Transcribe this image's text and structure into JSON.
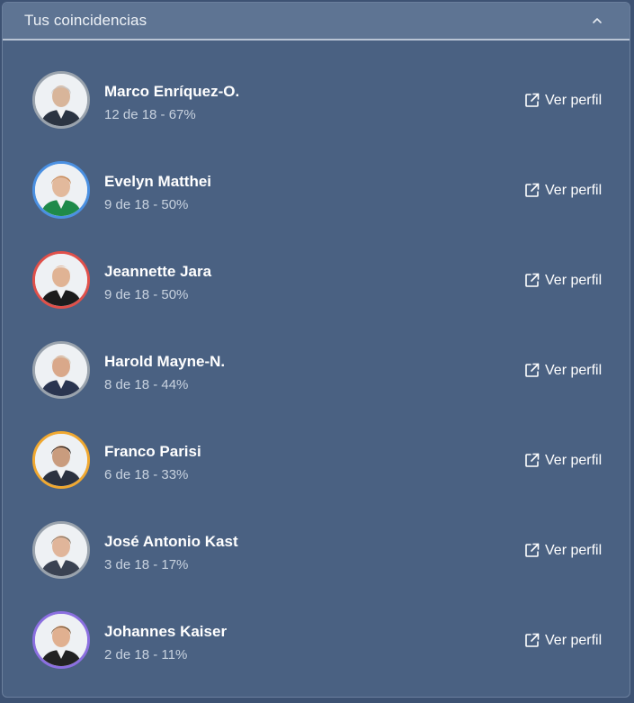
{
  "header": {
    "title": "Tus coincidencias"
  },
  "candidates": [
    {
      "name": "Marco Enríquez-O.",
      "score": "12 de 18 - 67%",
      "link": "Ver perfil",
      "ring_color": "#9aa3ad",
      "shirt": "#2b3442",
      "hair": "#c9c9c9",
      "skin": "#d8b59a"
    },
    {
      "name": "Evelyn Matthei",
      "score": "9 de 18 - 50%",
      "link": "Ver perfil",
      "ring_color": "#4a90e2",
      "shirt": "#1f8a4a",
      "hair": "#c48a5a",
      "skin": "#e2b99c"
    },
    {
      "name": "Jeannette Jara",
      "score": "9 de 18 - 50%",
      "link": "Ver perfil",
      "ring_color": "#e0504a",
      "shirt": "#1c1c1c",
      "hair": "#eeeeee",
      "skin": "#e0b394"
    },
    {
      "name": "Harold Mayne-N.",
      "score": "8 de 18 - 44%",
      "link": "Ver perfil",
      "ring_color": "#9aa3ad",
      "shirt": "#2a3550",
      "hair": "#d9d2c4",
      "skin": "#d9a88a"
    },
    {
      "name": "Franco Parisi",
      "score": "6 de 18 - 33%",
      "link": "Ver perfil",
      "ring_color": "#f0a830",
      "shirt": "#2c3240",
      "hair": "#2a241f",
      "skin": "#c99c7e"
    },
    {
      "name": "José Antonio Kast",
      "score": "3 de 18 - 17%",
      "link": "Ver perfil",
      "ring_color": "#9aa3ad",
      "shirt": "#3a4252",
      "hair": "#8a7a68",
      "skin": "#e0b59a"
    },
    {
      "name": "Johannes Kaiser",
      "score": "2 de 18 - 11%",
      "link": "Ver perfil",
      "ring_color": "#8b6fe0",
      "shirt": "#222222",
      "hair": "#7a5a3a",
      "skin": "#e0b090"
    }
  ]
}
